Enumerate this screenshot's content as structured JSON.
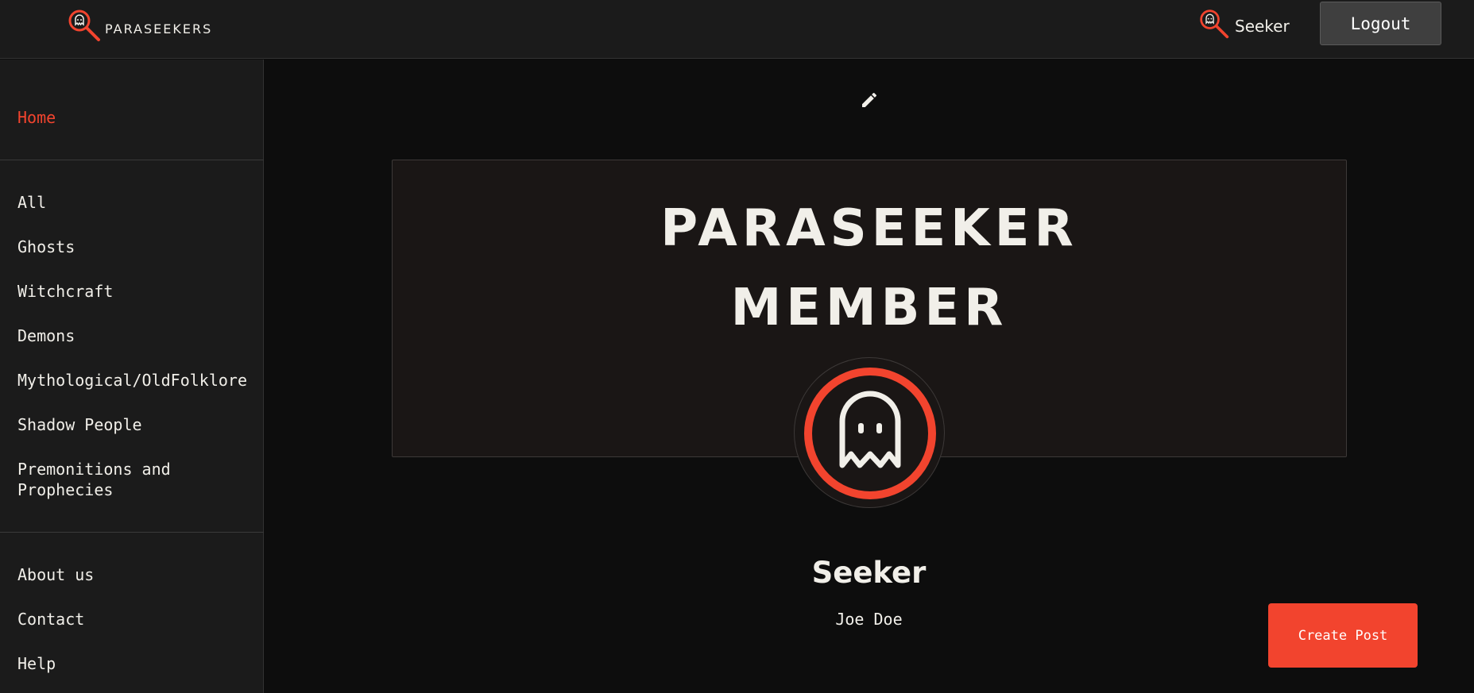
{
  "header": {
    "brand_name": "PARASEEKERS",
    "brand_icon": "magnifier-ghost-icon",
    "user_label": "Seeker",
    "user_icon": "magnifier-ghost-icon",
    "logout_label": "Logout"
  },
  "sidebar": {
    "home": "Home",
    "categories": [
      "All",
      "Ghosts",
      "Witchcraft",
      "Demons",
      "Mythological/OldFolklore",
      "Shadow People",
      "Premonitions and Prophecies"
    ],
    "footer_links": [
      "About us",
      "Contact",
      "Help"
    ]
  },
  "profile": {
    "edit_icon": "pencil-icon",
    "banner_line1": "PARASEEKER",
    "banner_line2": "MEMBER",
    "avatar_icon": "ghost-icon",
    "name": "Seeker",
    "full_name": "Joe Doe"
  },
  "actions": {
    "create_post": "Create Post"
  },
  "colors": {
    "accent": "#f2442e",
    "background": "#0d0d0d",
    "panel": "#1b1b1b",
    "text": "#f1efe9"
  }
}
